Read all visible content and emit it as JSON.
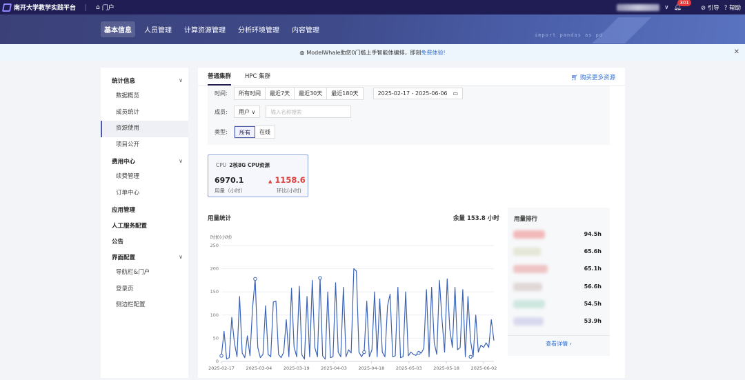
{
  "topbar": {
    "brand": "南开大学教学实践平台",
    "portal": "门户",
    "badge_count": "301",
    "guide": "引导",
    "help": "帮助"
  },
  "banner": {
    "code_text": "import pandas as pd"
  },
  "mainnav": {
    "items": [
      "基本信息",
      "人员管理",
      "计算资源管理",
      "分析环境管理",
      "内容管理"
    ]
  },
  "notice": {
    "text": "ModelWhale助您0门槛上手智能体编排，即刻",
    "link": "免费体验!"
  },
  "sidebar": {
    "g1": "统计信息",
    "g1_items": [
      "数据概览",
      "成员统计",
      "资源使用",
      "项目公开"
    ],
    "g2": "费用中心",
    "g2_items": [
      "续费管理",
      "订单中心"
    ],
    "g3": "应用管理",
    "g4": "人工服务配置",
    "g5": "公告",
    "g6": "界面配置",
    "g6_items": [
      "导航栏&门户",
      "登录页",
      "侧边栏配置"
    ]
  },
  "tabs": {
    "normal": "普通集群",
    "hpc": "HPC 集群",
    "buy": "购买更多资源"
  },
  "filters": {
    "time_label": "时间:",
    "time_options": [
      "所有时间",
      "最近7天",
      "最近30天",
      "最近180天"
    ],
    "date_range": "2025-02-17 - 2025-06-06",
    "member_label": "成员:",
    "member_select": "用户",
    "search_placeholder": "输入名称搜索",
    "type_label": "类型:",
    "type_options": [
      "所有",
      "在线"
    ]
  },
  "card": {
    "tag": "CPU",
    "name": "2核8G CPU资源",
    "usage_value": "6970.1",
    "usage_label": "用量（小时）",
    "change_value": "1158.6",
    "change_label": "环比(小时)"
  },
  "usage": {
    "title": "用量统计",
    "balance": "余量 153.8 小时"
  },
  "chart_data": {
    "type": "line",
    "ylabel": "时长(小时)",
    "ylim": [
      0,
      250
    ],
    "yticks": [
      0,
      50,
      100,
      150,
      200,
      250
    ],
    "xtick_labels": [
      "2025-02-17",
      "2025-03-04",
      "2025-03-19",
      "2025-04-03",
      "2025-04-18",
      "2025-05-03",
      "2025-05-18",
      "2025-06-02"
    ],
    "x_start": "2025-02-17",
    "x_end": "2025-06-06",
    "color": "#3b63b5",
    "series": [
      {
        "values": [
          12,
          65,
          5,
          8,
          95,
          40,
          10,
          140,
          18,
          8,
          55,
          12,
          115,
          178,
          30,
          8,
          15,
          120,
          15,
          10,
          128,
          130,
          15,
          8,
          20,
          90,
          10,
          158,
          31,
          10,
          162,
          14,
          5,
          140,
          10,
          175,
          30,
          10,
          180,
          12,
          5,
          150,
          8,
          10,
          170,
          20,
          10,
          160,
          10,
          25,
          18,
          200,
          195,
          20,
          10,
          20,
          130,
          10,
          25,
          150,
          10,
          135,
          20,
          10,
          120,
          145,
          10,
          12,
          160,
          8,
          10,
          150,
          12,
          20,
          15,
          13,
          22,
          18,
          28,
          155,
          10,
          160,
          40,
          15,
          175,
          90,
          20,
          178,
          70,
          30,
          160,
          25,
          30,
          155,
          10,
          140,
          45,
          10,
          100,
          20,
          35,
          30,
          40,
          30,
          90,
          45
        ]
      }
    ],
    "highlight_points": [
      [
        0,
        12
      ],
      [
        13,
        178
      ],
      [
        38,
        180
      ],
      [
        55,
        20
      ],
      [
        76,
        18
      ],
      [
        96,
        10
      ]
    ]
  },
  "ranking": {
    "title": "用量排行",
    "values": [
      "94.5h",
      "65.6h",
      "65.1h",
      "56.6h",
      "54.5h",
      "53.9h"
    ],
    "more": "查看详情"
  }
}
